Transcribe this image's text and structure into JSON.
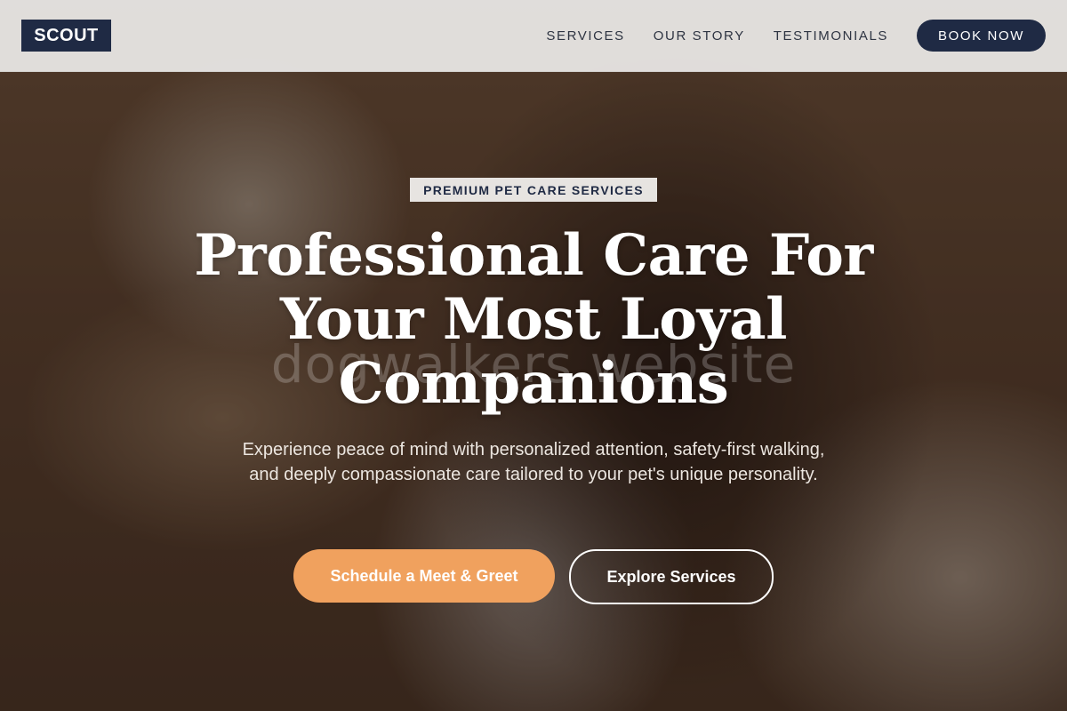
{
  "header": {
    "logo": "SCOUT",
    "nav": [
      {
        "label": "SERVICES"
      },
      {
        "label": "OUR STORY"
      },
      {
        "label": "TESTIMONIALS"
      }
    ],
    "cta_label": "BOOK NOW"
  },
  "hero": {
    "badge": "PREMIUM PET CARE SERVICES",
    "headline": "Professional Care For Your Most Loyal Companions",
    "watermark": "dogwalkers website",
    "subtext": "Experience peace of mind with personalized attention, safety-first walking, and deeply compassionate care tailored to your pet's unique personality.",
    "primary_cta": "Schedule a Meet & Greet",
    "secondary_cta": "Explore Services"
  },
  "colors": {
    "navy": "#1f2a44",
    "accent_orange": "#f0a15e",
    "header_bg": "#eceae8"
  }
}
